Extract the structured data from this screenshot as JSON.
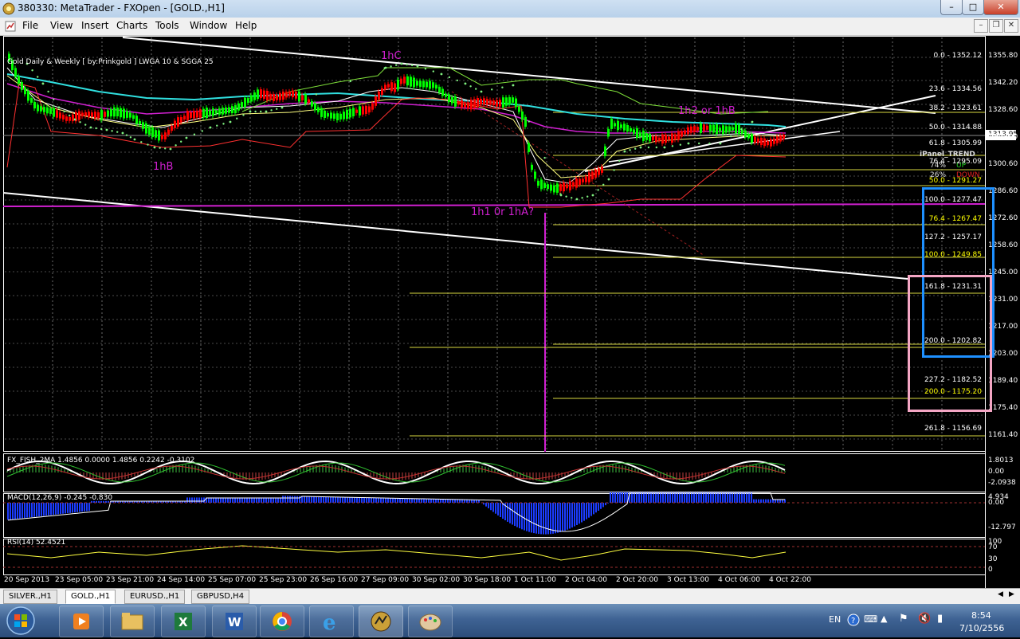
{
  "window": {
    "title": "380330: MetaTrader - FXOpen - [GOLD.,H1]",
    "min": "–",
    "max": "□",
    "close": "✕"
  },
  "menu": {
    "items": [
      "File",
      "View",
      "Insert",
      "Charts",
      "Tools",
      "Window",
      "Help"
    ]
  },
  "mdi": {
    "min": "–",
    "restore": "❐",
    "close": "✕"
  },
  "chart": {
    "header": "Gold Daily & Weekly [ by:Prinkgold ] LWGA 10  &  SGGA 25",
    "price_labels": [
      "1355.80",
      "1342.20",
      "1328.60",
      "1315.00",
      "1300.60",
      "1286.60",
      "1272.60",
      "1258.60",
      "1245.00",
      "1231.00",
      "1217.00",
      "1203.00",
      "1189.40",
      "1175.40",
      "1161.40"
    ],
    "current_price": "1313.95",
    "fib_labels": [
      {
        "text": "0.0 - 1352.12",
        "color": "#ffffff"
      },
      {
        "text": "23.6 - 1334.56",
        "color": "#ffffff"
      },
      {
        "text": "38.2 - 1323.61",
        "color": "#ffffff"
      },
      {
        "text": "50.0 - 1314.88",
        "color": "#ffffff"
      },
      {
        "text": "61.8 - 1305.99",
        "color": "#ffffff"
      },
      {
        "text": "76.4 - 1295.09",
        "color": "#ffffff"
      },
      {
        "text": "50.0 - 1291.27",
        "color": "#ffff00"
      },
      {
        "text": "100.0 - 1277.47",
        "color": "#ffffff"
      },
      {
        "text": "76.4 - 1267.47",
        "color": "#ffff00"
      },
      {
        "text": "127.2 - 1257.17",
        "color": "#ffffff"
      },
      {
        "text": "100.0 - 1249.85",
        "color": "#ffff00"
      },
      {
        "text": "161.8 - 1231.31",
        "color": "#ffffff"
      },
      {
        "text": "200.0 - 1202.82",
        "color": "#ffffff"
      },
      {
        "text": "227.2 - 1182.52",
        "color": "#ffffff"
      },
      {
        "text": "200.0 - 1175.20",
        "color": "#ffff00"
      },
      {
        "text": "261.8 - 1156.69",
        "color": "#ffffff"
      }
    ],
    "annotations": {
      "h1c": "1hC",
      "h1b": "1hB",
      "h1b2": "1h2 or 1hB",
      "h1a": "1h1 0r 1hA?"
    },
    "ipanel": {
      "title": "iPanel_TREND",
      "pct1": "74%",
      "pct2": "26%",
      "up": "UP",
      "down": "DOWN"
    },
    "indicators": {
      "fish": {
        "label": "FX_FISH_2MA 1.4856 0.0000 1.4856 0.2242 -0.3102",
        "axis_top": "1.8013",
        "axis_mid": "0.00",
        "axis_bot": "-2.0938"
      },
      "macd": {
        "label": "MACD(12,26,9) -0.245 -0.830",
        "axis_top": "4.934",
        "axis_mid": "0.00",
        "axis_bot": "-12.797"
      },
      "rsi": {
        "label": "RSI(14) 52.4521",
        "axis_top": "100",
        "axis_70": "70",
        "axis_30": "30",
        "axis_bot": "0"
      }
    },
    "time_labels": [
      "20 Sep 2013",
      "23 Sep 05:00",
      "23 Sep 21:00",
      "24 Sep 14:00",
      "25 Sep 07:00",
      "25 Sep 23:00",
      "26 Sep 16:00",
      "27 Sep 09:00",
      "30 Sep 02:00",
      "30 Sep 18:00",
      "1 Oct 11:00",
      "2 Oct 04:00",
      "2 Oct 20:00",
      "3 Oct 13:00",
      "4 Oct 06:00",
      "4 Oct 22:00"
    ],
    "colors": {
      "bull": "#00ff00",
      "bear": "#ff0000",
      "magenta": "#d020d0",
      "blue_box": "#1e90ff",
      "pink_box": "#f4a6c4"
    }
  },
  "tabs": [
    "SILVER.,H1",
    "GOLD.,H1",
    "EURUSD.,H1",
    "GBPUSD,H4"
  ],
  "active_tab": "GOLD.,H1",
  "taskbar": {
    "lang": "EN",
    "time": "8:54",
    "date": "7/10/2556"
  }
}
